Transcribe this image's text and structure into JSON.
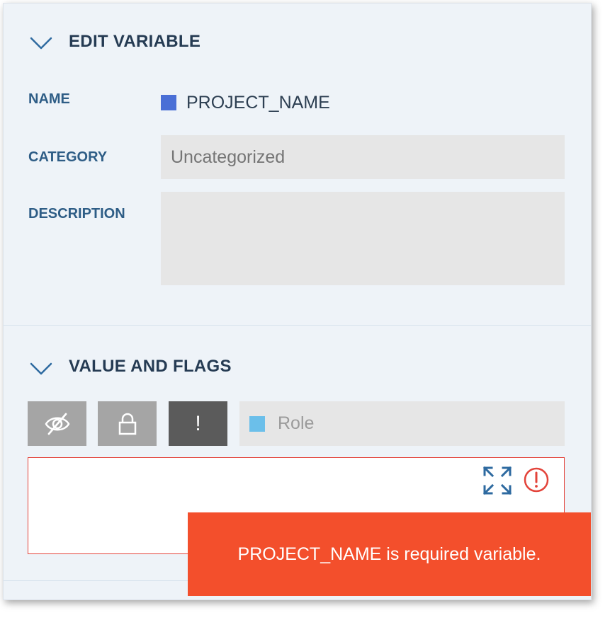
{
  "edit_section": {
    "title": "EDIT VARIABLE",
    "name_label": "NAME",
    "name_value": "PROJECT_NAME",
    "name_color": "#4a6fd6",
    "category_label": "CATEGORY",
    "category_placeholder": "Uncategorized",
    "description_label": "DESCRIPTION",
    "description_value": ""
  },
  "flags_section": {
    "title": "VALUE AND FLAGS",
    "flags": [
      {
        "icon": "eye-slash-icon",
        "color": "#a5a5a5"
      },
      {
        "icon": "lock-icon",
        "color": "#a5a5a5"
      },
      {
        "icon": "exclamation-icon",
        "color": "#5b5b5b",
        "text": "!"
      }
    ],
    "role_placeholder": "Role",
    "role_color": "#6bbfea",
    "value": "",
    "expand_icon": "expand-arrows-icon",
    "error_icon": "alert-circle-icon"
  },
  "toast": {
    "message": "PROJECT_NAME is required variable.",
    "color": "#f34f2c"
  }
}
